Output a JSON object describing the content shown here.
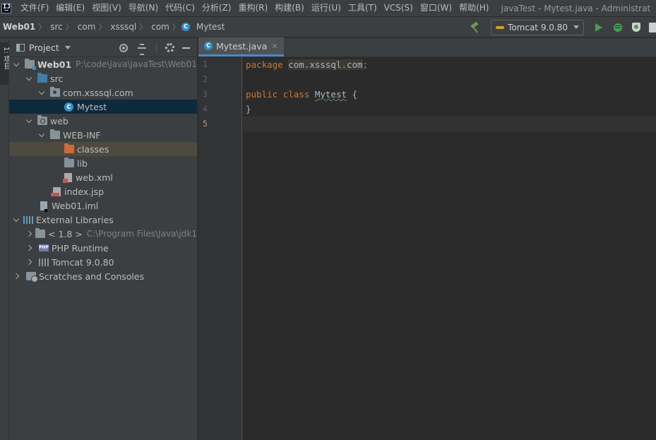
{
  "menu": {
    "items": [
      "文件(F)",
      "编辑(E)",
      "视图(V)",
      "导航(N)",
      "代码(C)",
      "分析(Z)",
      "重构(R)",
      "构建(B)",
      "运行(U)",
      "工具(T)",
      "VCS(S)",
      "窗口(W)",
      "帮助(H)"
    ],
    "window_title": "javaTest - Mytest.java - Administrat"
  },
  "navbar": {
    "crumbs": [
      "Web01",
      "src",
      "com",
      "xsssql",
      "com",
      "Mytest"
    ],
    "run_config": "Tomcat 9.0.80"
  },
  "tool_stripe": {
    "project_tab": "1: 项目"
  },
  "project_panel": {
    "title": "Project",
    "tree": [
      {
        "label": "Web01",
        "path": "P:\\code\\java\\javaTest\\Web01"
      },
      {
        "label": "src"
      },
      {
        "label": "com.xsssql.com"
      },
      {
        "label": "Mytest"
      },
      {
        "label": "web"
      },
      {
        "label": "WEB-INF"
      },
      {
        "label": "classes"
      },
      {
        "label": "lib"
      },
      {
        "label": "web.xml"
      },
      {
        "label": "index.jsp"
      },
      {
        "label": "Web01.iml"
      },
      {
        "label": "External Libraries"
      },
      {
        "label": "< 1.8 >",
        "path": "C:\\Program Files\\Java\\jdk1"
      },
      {
        "label": "PHP Runtime"
      },
      {
        "label": "Tomcat 9.0.80"
      },
      {
        "label": "Scratches and Consoles"
      }
    ]
  },
  "editor": {
    "tab_label": "Mytest.java",
    "line_numbers": [
      "1",
      "2",
      "3",
      "4",
      "5"
    ],
    "code": {
      "l1_kw": "package",
      "l1_pkg": "com.xsssql.com",
      "l1_semi": ";",
      "l3_kw1": "public",
      "l3_kw2": "class",
      "l3_name": "Mytest",
      "l3_brace": "{",
      "l4_brace": "}"
    }
  },
  "colors": {
    "background": "#2b2b2b",
    "panel": "#3c3f41",
    "accent": "#4a88c7",
    "keyword": "#cc7832",
    "selection": "#0d293e"
  }
}
